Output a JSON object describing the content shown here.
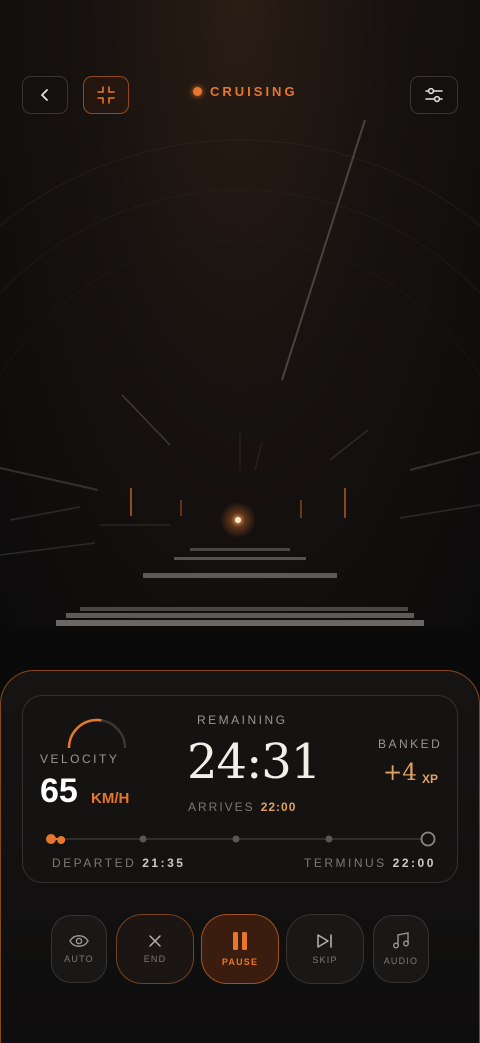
{
  "header": {
    "status_label": "CRUISING",
    "back_icon": "chevron-left-icon",
    "collapse_icon": "minimize-icon",
    "settings_icon": "sliders-icon"
  },
  "trip": {
    "velocity_label": "VELOCITY",
    "velocity_value": "65",
    "velocity_unit": "KM/H",
    "velocity_gauge_level": 0.55,
    "remaining_label": "REMAINING",
    "remaining_time": "24:31",
    "arrives_label": "ARRIVES",
    "arrives_time": "22:00",
    "banked_label": "BANKED",
    "banked_value": "+4",
    "banked_unit": "XP",
    "progress": 0.03,
    "waypoints": 4,
    "departed_label": "DEPARTED",
    "departed_time": "21:35",
    "terminus_label": "TERMINUS",
    "terminus_time": "22:00"
  },
  "controls": [
    {
      "label": "AUTO",
      "icon": "eye-icon"
    },
    {
      "label": "END",
      "icon": "close-icon"
    },
    {
      "label": "PAUSE",
      "icon": "pause-icon"
    },
    {
      "label": "SKIP",
      "icon": "skip-icon"
    },
    {
      "label": "AUDIO",
      "icon": "music-icon"
    }
  ],
  "colors": {
    "accent": "#e8762c",
    "gold": "#e0a060",
    "background": "#0b0a0a"
  }
}
